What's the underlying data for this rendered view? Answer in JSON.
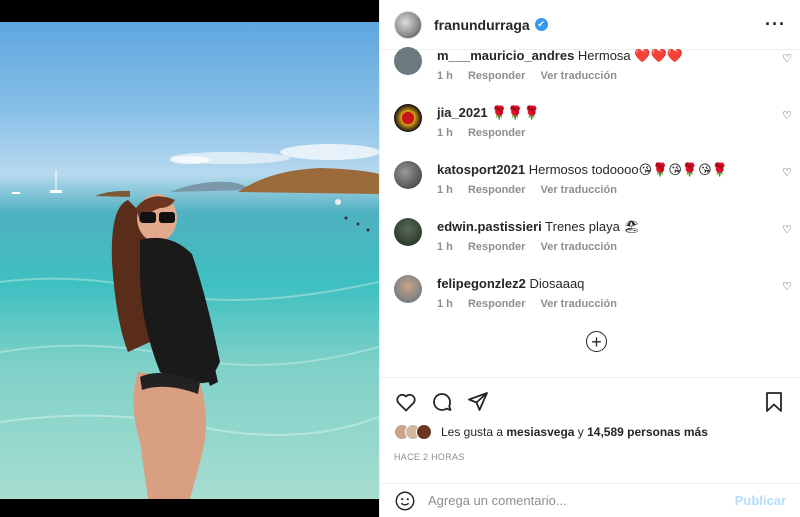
{
  "header": {
    "username": "franundurraga",
    "verified_mark": "✔",
    "more_label": "···"
  },
  "comments": [
    {
      "user": "m___mauricio_andres",
      "text": "Hermosa ❤️❤️❤️",
      "time": "1 h",
      "reply": "Responder",
      "translate": "Ver traducción",
      "avatar_color": "#6b7a7e"
    },
    {
      "user": "jia_2021",
      "text": "🌹🌹🌹",
      "time": "1 h",
      "reply": "Responder",
      "translate": "",
      "avatar_color": "#e3a21a"
    },
    {
      "user": "katosport2021",
      "text": "Hermosos todoooo😘🌹😘🌹😘🌹",
      "time": "1 h",
      "reply": "Responder",
      "translate": "Ver traducción",
      "avatar_color": "#555555"
    },
    {
      "user": "edwin.pastissieri",
      "text": "Trenes playa 🏖",
      "time": "1 h",
      "reply": "Responder",
      "translate": "Ver traducción",
      "avatar_color": "#3a4a3c"
    },
    {
      "user": "felipegonzlez2",
      "text": "Diosaaaq",
      "time": "1 h",
      "reply": "Responder",
      "translate": "Ver traducción",
      "avatar_color": "#8a9aa8"
    }
  ],
  "add_more_label": "+",
  "likes": {
    "prefix": "Les gusta a ",
    "user": "mesiasvega",
    "middle": " y ",
    "count": "14,589 personas más"
  },
  "time": "HACE 2 HORAS",
  "composer": {
    "placeholder": "Agrega un comentario...",
    "publish": "Publicar"
  },
  "icons": {
    "heart": "heart-icon",
    "comment": "comment-icon",
    "share": "share-icon",
    "save": "bookmark-icon",
    "emoji": "emoji-icon"
  }
}
